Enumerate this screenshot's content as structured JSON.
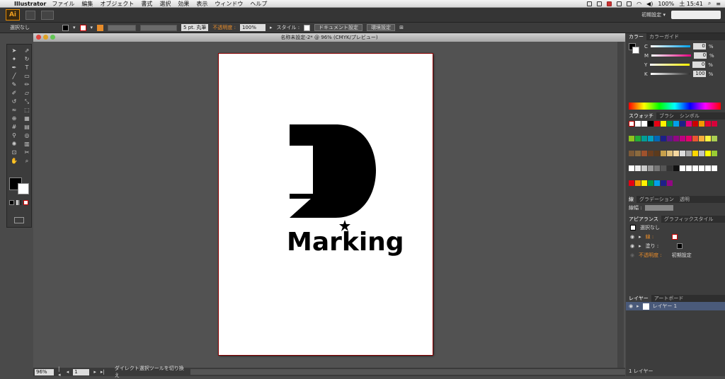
{
  "menubar": {
    "app_name": "Illustrator",
    "items": [
      "ファイル",
      "編集",
      "オブジェクト",
      "書式",
      "選択",
      "効果",
      "表示",
      "ウィンドウ",
      "ヘルプ"
    ],
    "battery": "100%",
    "clock": "土 15:41"
  },
  "appbar": {
    "logo": "Ai",
    "workspace": "初期設定 ▾"
  },
  "control": {
    "selection": "選択なし",
    "stroke_label": "5 pt. 丸筆",
    "opacity_label": "不透明度 :",
    "opacity_value": "100%",
    "style_label": "スタイル :",
    "doc_setup": "ドキュメント設定",
    "preferences": "環境設定"
  },
  "document": {
    "title": "名称未設定-2* @ 96% (CMYK/プレビュー)",
    "logo_text": "Marking"
  },
  "status": {
    "zoom": "96%",
    "page": "1",
    "message": "ダイレクト選択ツールを切り換え"
  },
  "color_panel": {
    "tabs": [
      "カラー",
      "カラーガイド"
    ],
    "channels": [
      {
        "name": "C",
        "value": "0",
        "unit": "%"
      },
      {
        "name": "M",
        "value": "0",
        "unit": "%"
      },
      {
        "name": "Y",
        "value": "0",
        "unit": "%"
      },
      {
        "name": "K",
        "value": "100",
        "unit": "%"
      }
    ]
  },
  "swatch_panel": {
    "tabs": [
      "スウォッチ",
      "ブラシ",
      "シンボル"
    ]
  },
  "stroke_panel": {
    "tabs": [
      "線",
      "グラデーション",
      "透明"
    ],
    "weight_label": "線幅 :"
  },
  "appearance_panel": {
    "tabs": [
      "アピアランス",
      "グラフィックスタイル"
    ],
    "title": "選択なし",
    "stroke": "線 :",
    "fill": "塗り :",
    "opacity": "不透明度 :",
    "opacity_value": "初期設定"
  },
  "layers_panel": {
    "tabs": [
      "レイヤー",
      "アートボード"
    ],
    "layer_name": "レイヤー 1",
    "footer": "1 レイヤー"
  },
  "colors": {
    "accent": "#e88c2a",
    "artboard_border": "#8a0000"
  }
}
